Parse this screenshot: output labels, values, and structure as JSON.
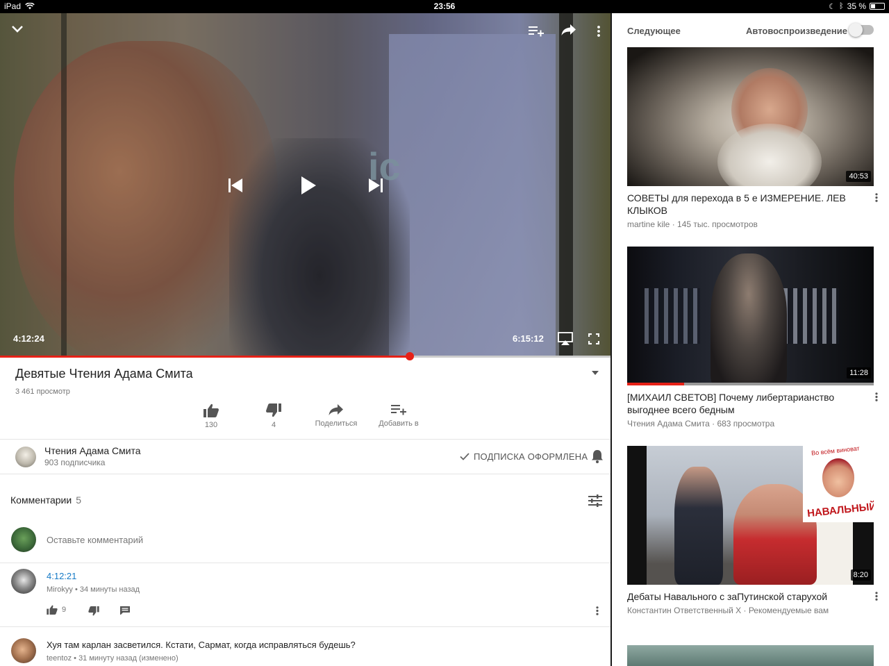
{
  "status_bar": {
    "device": "iPad",
    "time": "23:56",
    "battery": "35 %"
  },
  "player": {
    "current_time": "4:12:24",
    "duration": "6:15:12",
    "progress_fraction": 0.671,
    "overlay_text": "ic"
  },
  "video": {
    "title": "Девятые Чтения Адама Смита",
    "views": "3 461 просмотр"
  },
  "actions": {
    "likes": "130",
    "dislikes": "4",
    "share_label": "Поделиться",
    "add_label": "Добавить в"
  },
  "channel": {
    "name": "Чтения Адама Смита",
    "subscribers": "903 подписчика",
    "subscribed_label": "ПОДПИСКА ОФОРМЛЕНА"
  },
  "comments": {
    "header": "Комментарии",
    "count": "5",
    "add_placeholder": "Оставьте комментарий",
    "items": [
      {
        "text": "4:12:21",
        "author": "Mirokyy",
        "time": "34 минуты назад",
        "likes": "9"
      },
      {
        "text": "Хуя там карлан засветился. Кстати, Сармат, когда исправляться будешь?",
        "author": "teentoz",
        "time": "31 минуту назад (изменено)"
      }
    ]
  },
  "sidebar": {
    "up_next_label": "Следующее",
    "autoplay_label": "Автовоспроизведение",
    "autoplay_on": false,
    "recommendations": [
      {
        "title": "СОВЕТЫ для перехода в 5 е ИЗМЕРЕНИЕ. ЛЕВ КЛЫКОВ",
        "meta": "martine kile · 145 тыс. просмотров",
        "duration": "40:53"
      },
      {
        "title": "[МИХАИЛ СВЕТОВ] Почему либертарианство выгоднее всего бедным",
        "meta": "Чтения Адама Смита · 683 просмотра",
        "duration": "11:28",
        "watched_fraction": 0.23
      },
      {
        "title": "Дебаты Навального с заПутинской старухой",
        "meta": "Константин Ответственный Х · Рекомендуемые вам",
        "duration": "8:20",
        "poster_top": "Во всём виноват",
        "poster_word": "НАВАЛЬНЫЙ"
      }
    ]
  },
  "colors": {
    "accent_red": "#e62117",
    "link_blue": "#167ac6",
    "text_secondary": "#767676"
  }
}
